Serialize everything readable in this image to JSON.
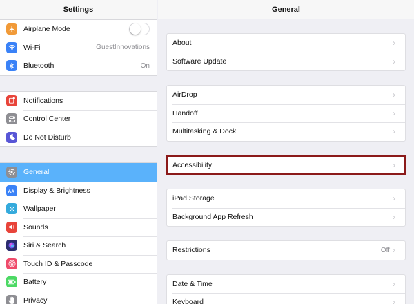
{
  "left_panel": {
    "title": "Settings",
    "groups": [
      [
        {
          "label": "Airplane Mode",
          "icon": "airplane-icon",
          "color": "#f19a38",
          "accessory": "toggle",
          "value": ""
        },
        {
          "label": "Wi-Fi",
          "icon": "wifi-icon",
          "color": "#3a82f7",
          "accessory": "value",
          "value": "GuestInnovations"
        },
        {
          "label": "Bluetooth",
          "icon": "bluetooth-icon",
          "color": "#3a82f7",
          "accessory": "value",
          "value": "On"
        }
      ],
      [
        {
          "label": "Notifications",
          "icon": "notifications-icon",
          "color": "#e8443a",
          "accessory": "none",
          "value": ""
        },
        {
          "label": "Control Center",
          "icon": "control-center-icon",
          "color": "#8e8e93",
          "accessory": "none",
          "value": ""
        },
        {
          "label": "Do Not Disturb",
          "icon": "moon-icon",
          "color": "#5856d6",
          "accessory": "none",
          "value": ""
        }
      ],
      [
        {
          "label": "General",
          "icon": "gear-icon",
          "color": "#8e8e93",
          "accessory": "none",
          "value": "",
          "selected": true
        },
        {
          "label": "Display & Brightness",
          "icon": "display-brightness-icon",
          "color": "#3a82f7",
          "accessory": "none",
          "value": ""
        },
        {
          "label": "Wallpaper",
          "icon": "wallpaper-icon",
          "color": "#34aadc",
          "accessory": "none",
          "value": ""
        },
        {
          "label": "Sounds",
          "icon": "sounds-icon",
          "color": "#e8443a",
          "accessory": "none",
          "value": ""
        },
        {
          "label": "Siri & Search",
          "icon": "siri-icon",
          "color": "#2c2c6e",
          "accessory": "none",
          "value": ""
        },
        {
          "label": "Touch ID & Passcode",
          "icon": "fingerprint-icon",
          "color": "#ef4b6b",
          "accessory": "none",
          "value": ""
        },
        {
          "label": "Battery",
          "icon": "battery-icon",
          "color": "#4cd964",
          "accessory": "none",
          "value": ""
        },
        {
          "label": "Privacy",
          "icon": "privacy-hand-icon",
          "color": "#8e8e93",
          "accessory": "none",
          "value": ""
        }
      ]
    ]
  },
  "right_panel": {
    "title": "General",
    "groups": [
      [
        {
          "label": "About",
          "value": ""
        },
        {
          "label": "Software Update",
          "value": ""
        }
      ],
      [
        {
          "label": "AirDrop",
          "value": ""
        },
        {
          "label": "Handoff",
          "value": ""
        },
        {
          "label": "Multitasking & Dock",
          "value": ""
        }
      ],
      [
        {
          "label": "Accessibility",
          "value": "",
          "highlighted": true
        }
      ],
      [
        {
          "label": "iPad Storage",
          "value": ""
        },
        {
          "label": "Background App Refresh",
          "value": ""
        }
      ],
      [
        {
          "label": "Restrictions",
          "value": "Off"
        }
      ],
      [
        {
          "label": "Date & Time",
          "value": ""
        },
        {
          "label": "Keyboard",
          "value": ""
        }
      ]
    ]
  },
  "colors": {
    "selected_row": "#5ab2fb",
    "highlight_outline": "#8b1a1a",
    "background": "#efeff4"
  }
}
